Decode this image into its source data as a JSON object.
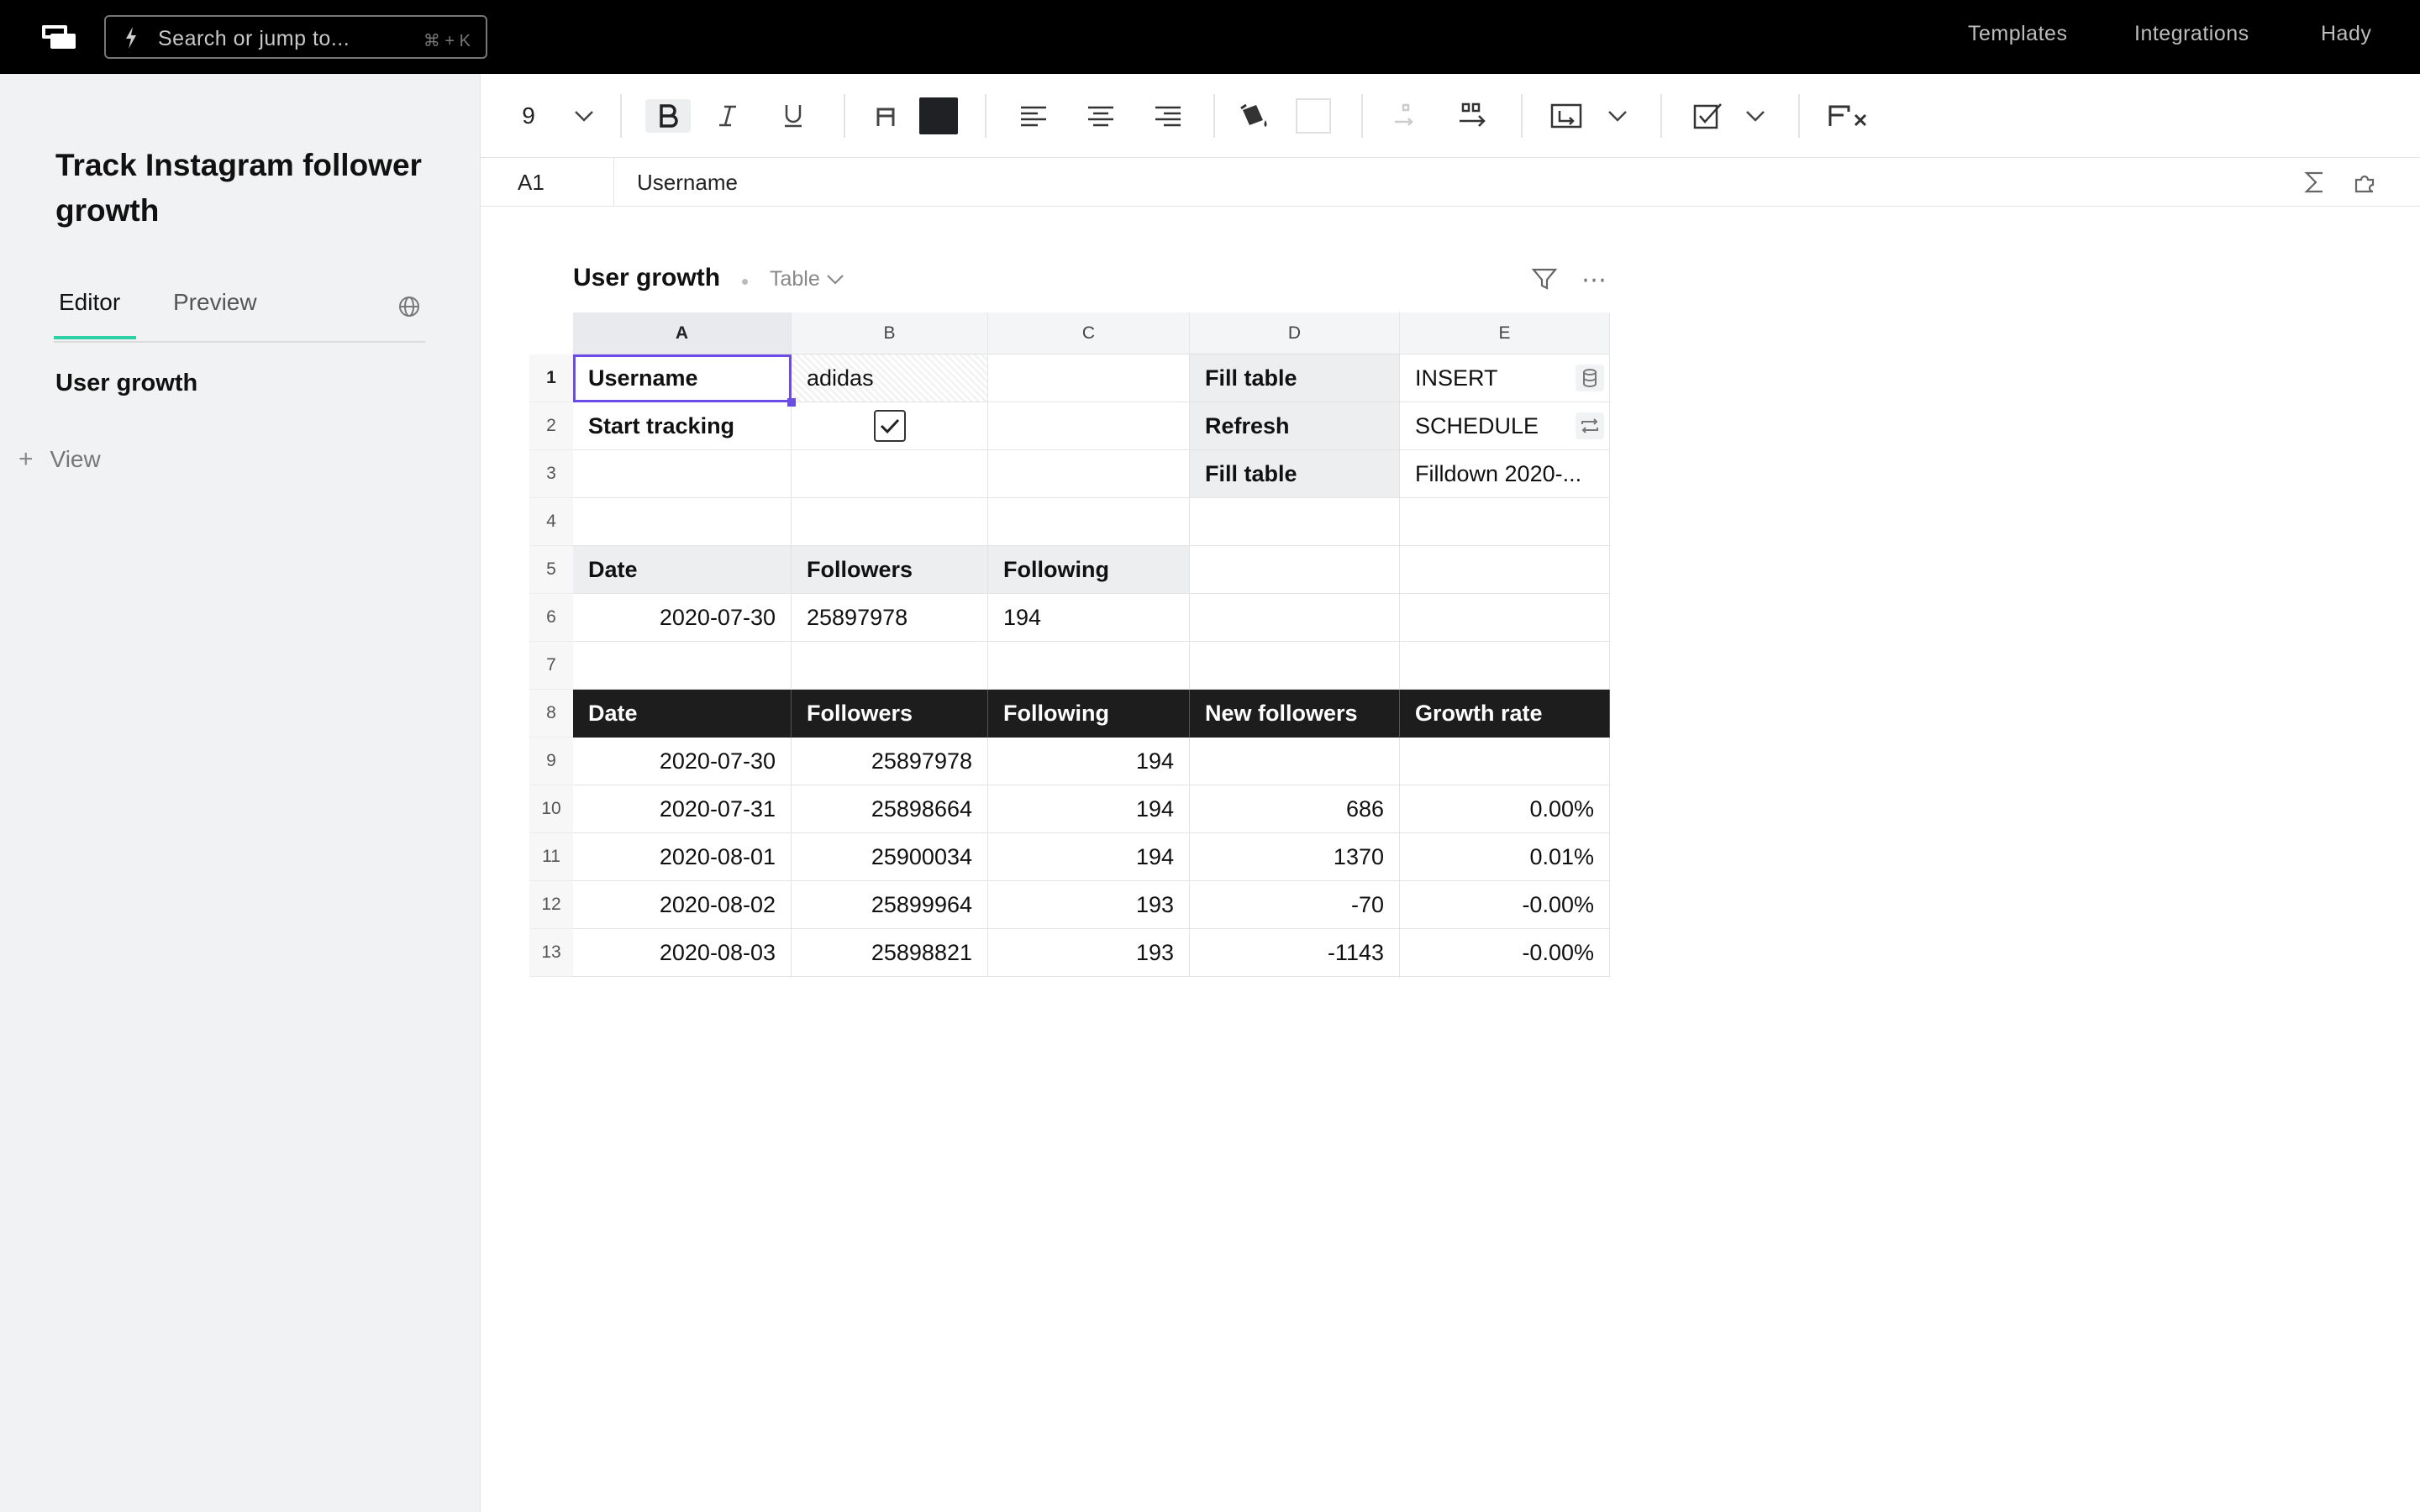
{
  "topbar": {
    "search_placeholder": "Search or jump to...",
    "search_shortcut": "⌘ + K",
    "nav": [
      "Templates",
      "Integrations",
      "Hady"
    ]
  },
  "sidebar": {
    "title": "Track Instagram follower growth",
    "tabs": [
      "Editor",
      "Preview"
    ],
    "items": [
      "User growth"
    ],
    "add_view_label": "View"
  },
  "toolbar": {
    "font_size": "9",
    "text_color": "#1f2124",
    "fill_color": "#ffffff"
  },
  "formula_bar": {
    "cell_ref": "A1",
    "value": "Username"
  },
  "table": {
    "title": "User growth",
    "view_type": "Table",
    "columns": [
      "A",
      "B",
      "C",
      "D",
      "E"
    ],
    "rows": [
      "1",
      "2",
      "3",
      "4",
      "5",
      "6",
      "7",
      "8",
      "9",
      "10",
      "11",
      "12",
      "13"
    ],
    "config": {
      "username_label": "Username",
      "username_value": "adidas",
      "start_tracking_label": "Start tracking",
      "start_tracking_checked": true,
      "actions": [
        {
          "label": "Fill table",
          "value": "INSERT",
          "icon": "database-icon"
        },
        {
          "label": "Refresh",
          "value": "SCHEDULE",
          "icon": "repeat-icon"
        },
        {
          "label": "Fill table",
          "value": "Filldown 2020-..."
        }
      ]
    },
    "current": {
      "headers": [
        "Date",
        "Followers",
        "Following"
      ],
      "row": [
        "2020-07-30",
        "25897978",
        "194"
      ]
    },
    "history": {
      "headers": [
        "Date",
        "Followers",
        "Following",
        "New followers",
        "Growth rate"
      ],
      "rows": [
        [
          "2020-07-30",
          "25897978",
          "194",
          "",
          ""
        ],
        [
          "2020-07-31",
          "25898664",
          "194",
          "686",
          "0.00%"
        ],
        [
          "2020-08-01",
          "25900034",
          "194",
          "1370",
          "0.01%"
        ],
        [
          "2020-08-02",
          "25899964",
          "193",
          "-70",
          "-0.00%"
        ],
        [
          "2020-08-03",
          "25898821",
          "193",
          "-1143",
          "-0.00%"
        ]
      ]
    }
  }
}
